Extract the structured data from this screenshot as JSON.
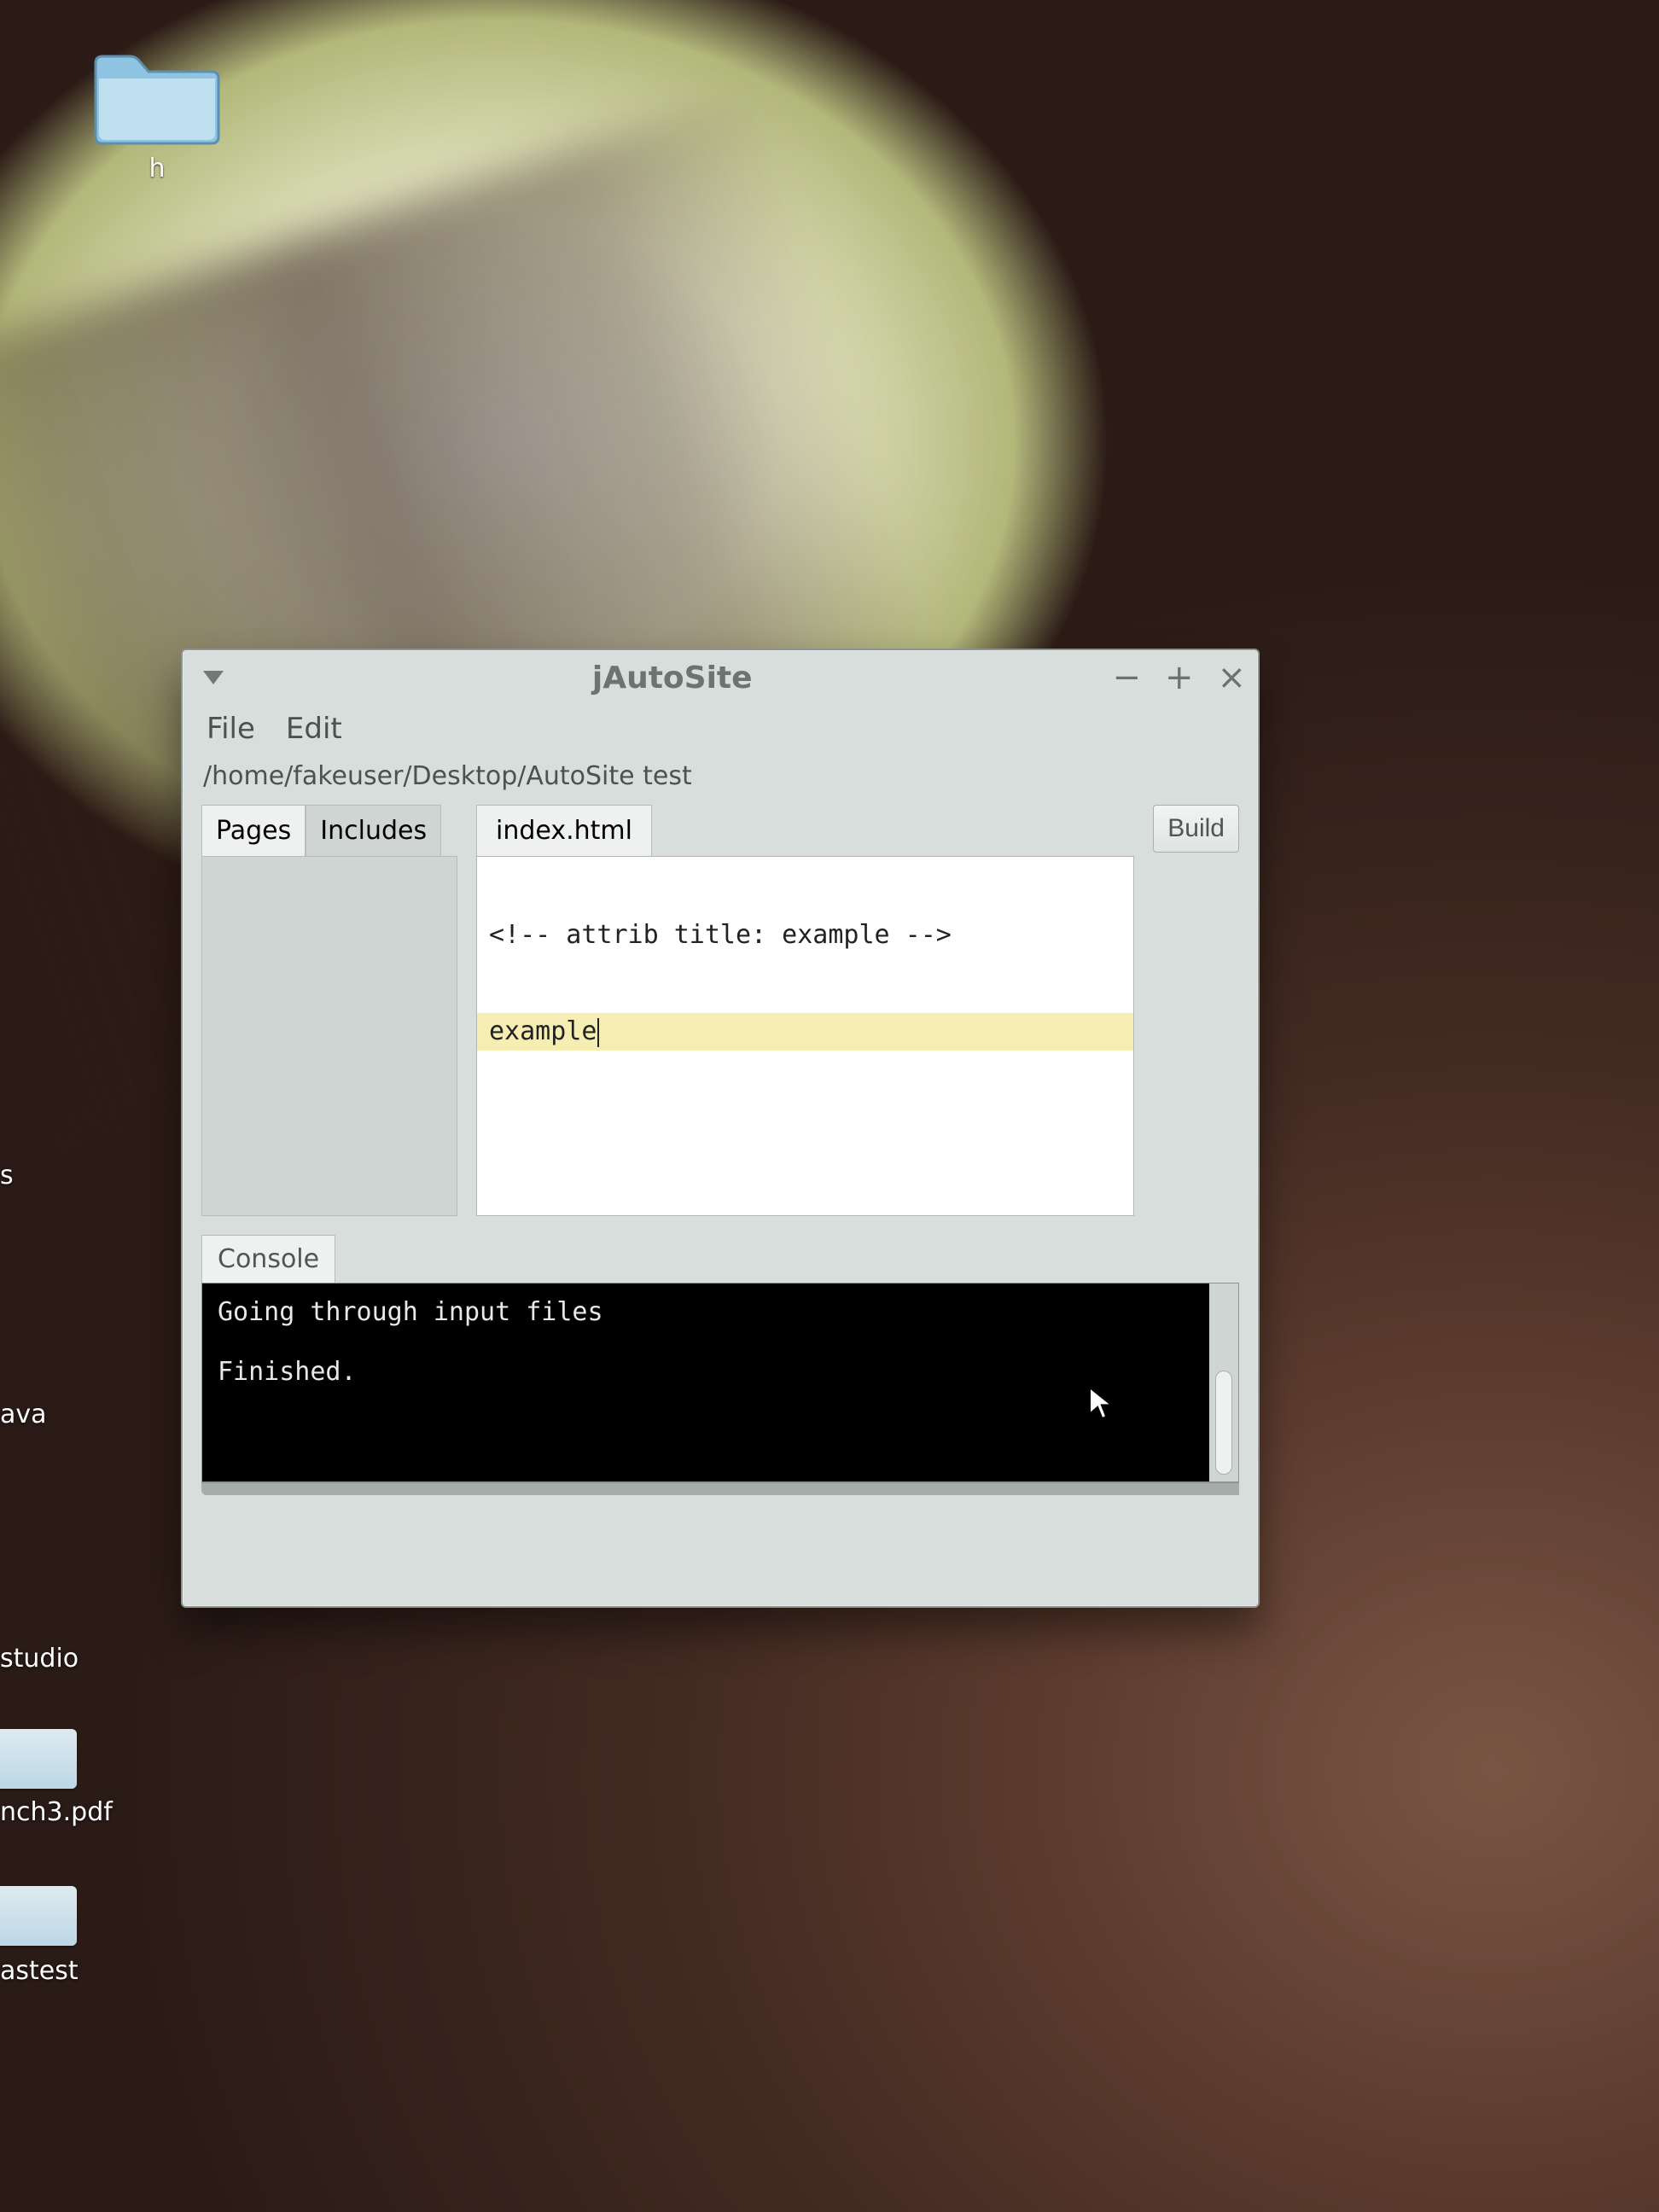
{
  "desktop": {
    "folder": {
      "label": "h"
    },
    "edge_labels": {
      "s1": "s",
      "ava": "ava",
      "studio": "studio",
      "pdf": "nch3.pdf",
      "astest": "astest"
    }
  },
  "window": {
    "title": "jAutoSite",
    "menus": {
      "file": "File",
      "edit": "Edit"
    },
    "path": "/home/fakeuser/Desktop/AutoSite test",
    "side_tabs": {
      "pages": "Pages",
      "includes": "Includes"
    },
    "doc_tabs": {
      "file": "index.html"
    },
    "build_label": "Build",
    "editor": {
      "line1": "<!-- attrib title: example -->",
      "line2": "example"
    },
    "console_tab": "Console",
    "console_text": "Going through input files\n\nFinished."
  }
}
